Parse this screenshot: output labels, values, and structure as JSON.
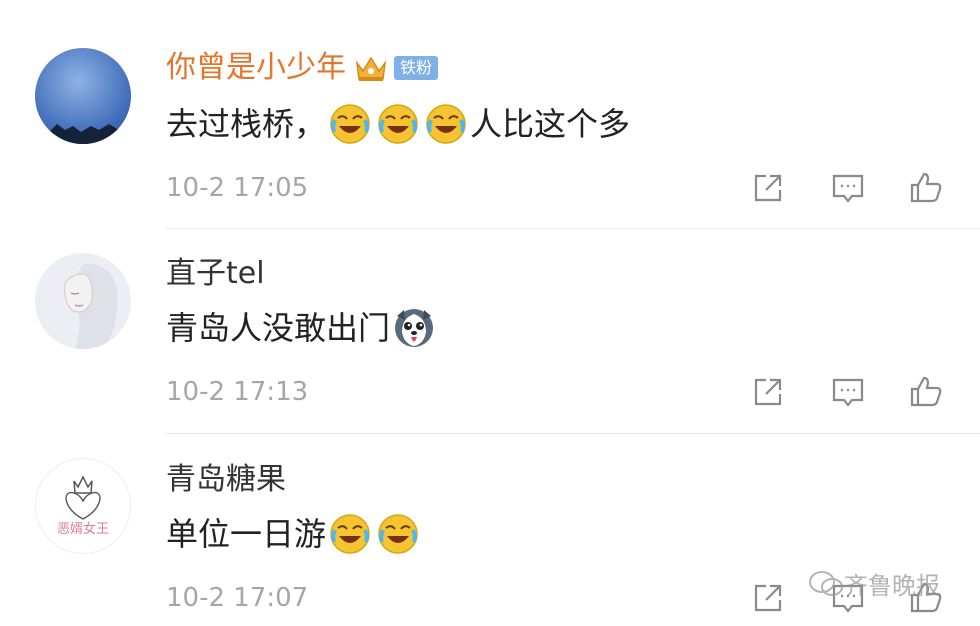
{
  "comments": [
    {
      "username": "你曾是小少年",
      "fan_badge": "铁粉",
      "text_before": "去过栈桥，",
      "text_after": "人比这个多",
      "emoji_icons": [
        "laugh-cry-emoji",
        "laugh-cry-emoji",
        "laugh-cry-emoji"
      ],
      "time": "10-2 17:05"
    },
    {
      "username": "直子tel",
      "text_before": "青岛人没敢出门",
      "emoji_icons": [
        "husky-dog-emoji"
      ],
      "time": "10-2 17:13"
    },
    {
      "username": "青岛糖果",
      "text_before": "单位一日游",
      "emoji_icons": [
        "laugh-cry-emoji",
        "laugh-cry-emoji"
      ],
      "time": "10-2 17:07"
    }
  ],
  "avatar_texts": {
    "comment_3": "恶婿女王"
  },
  "action_icons": [
    "share-icon",
    "comment-icon",
    "like-icon"
  ],
  "watermark": "齐鲁晚报",
  "colors": {
    "vip_name": "#e5752b",
    "name": "#333333",
    "time": "#a6a6a6",
    "badge": "#7fb0e8"
  }
}
